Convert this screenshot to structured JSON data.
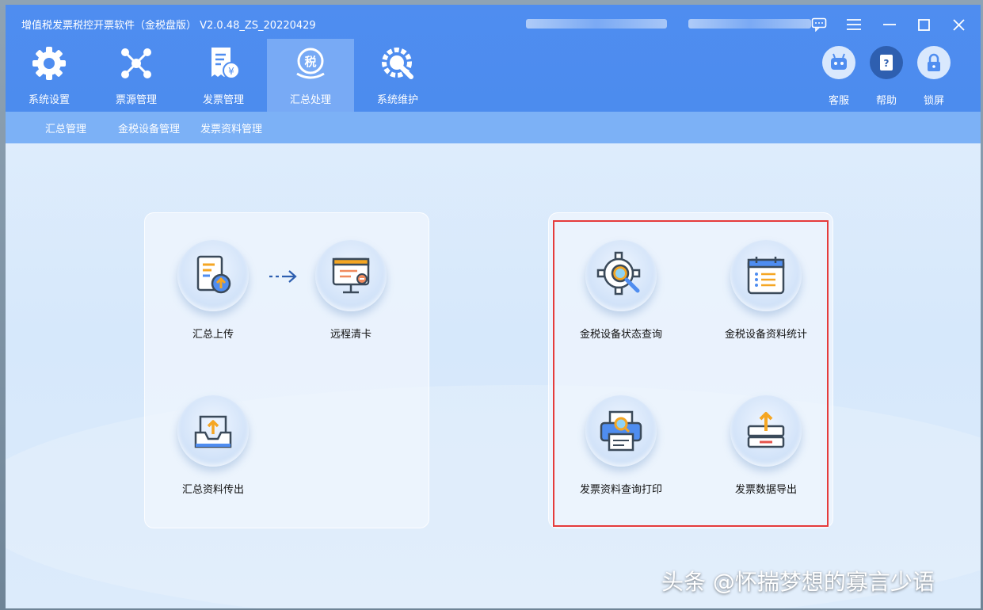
{
  "window": {
    "title": "增值税发票税控开票软件（金税盘版） V2.0.48_ZS_20220429"
  },
  "toolbar": {
    "tabs": [
      {
        "label": "系统设置",
        "icon": "gear-icon"
      },
      {
        "label": "票源管理",
        "icon": "network-icon"
      },
      {
        "label": "发票管理",
        "icon": "invoice-icon"
      },
      {
        "label": "汇总处理",
        "icon": "tax-icon",
        "active": true
      },
      {
        "label": "系统维护",
        "icon": "wrench-gear-icon"
      }
    ],
    "right_buttons": [
      {
        "label": "客服",
        "icon": "robot-icon"
      },
      {
        "label": "帮助",
        "icon": "help-book-icon"
      },
      {
        "label": "锁屏",
        "icon": "lock-icon"
      }
    ]
  },
  "submenu": {
    "items": [
      "汇总管理",
      "金税设备管理",
      "发票资料管理"
    ]
  },
  "left_panel": {
    "items": [
      {
        "label": "汇总上传",
        "icon": "upload-document-icon"
      },
      {
        "label": "远程清卡",
        "icon": "remote-monitor-icon"
      },
      {
        "label": "汇总资料传出",
        "icon": "tray-upload-icon"
      }
    ]
  },
  "right_panel": {
    "items": [
      {
        "label": "金税设备状态查询",
        "icon": "gear-search-icon"
      },
      {
        "label": "金税设备资料统计",
        "icon": "calendar-list-icon"
      },
      {
        "label": "发票资料查询打印",
        "icon": "printer-search-icon"
      },
      {
        "label": "发票数据导出",
        "icon": "export-icon"
      }
    ]
  },
  "watermark": "头条 @怀揣梦想的寡言少语",
  "colors": {
    "title_bar": "#4f8df0",
    "active_tab": "#78aaf5",
    "submenu_bar": "#7cb1f6",
    "highlight_border": "#e53b3b",
    "accent_orange": "#f5a623"
  }
}
